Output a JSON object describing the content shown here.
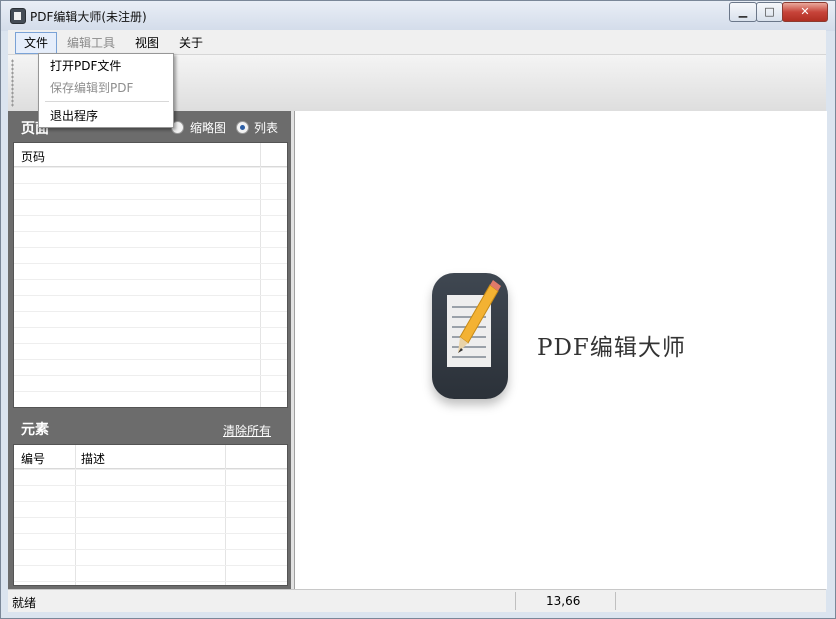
{
  "window": {
    "title": "PDF编辑大师(未注册)"
  },
  "menu": {
    "items": [
      {
        "label": "文件"
      },
      {
        "label": "编辑工具"
      },
      {
        "label": "视图"
      },
      {
        "label": "关于"
      }
    ],
    "file_dropdown": [
      {
        "label": "打开PDF文件",
        "enabled": true
      },
      {
        "label": "保存编辑到PDF",
        "enabled": false
      },
      {
        "label": "退出程序",
        "enabled": true
      }
    ]
  },
  "pages_panel": {
    "title": "页面",
    "view_options": [
      {
        "label": "缩略图",
        "selected": false
      },
      {
        "label": "列表",
        "selected": true
      }
    ],
    "columns": [
      "页码"
    ]
  },
  "elements_panel": {
    "title": "元素",
    "clear_all": "清除所有",
    "columns": [
      "编号",
      "描述"
    ]
  },
  "canvas": {
    "brand_text": "PDF编辑大师"
  },
  "status": {
    "text": "就绪",
    "coords": "13,66"
  },
  "colors": {
    "panel_bg": "#6c6c6c",
    "accent": "#2c5ea5",
    "logo_bg": "#3f4751",
    "pencil": "#f3b233"
  }
}
